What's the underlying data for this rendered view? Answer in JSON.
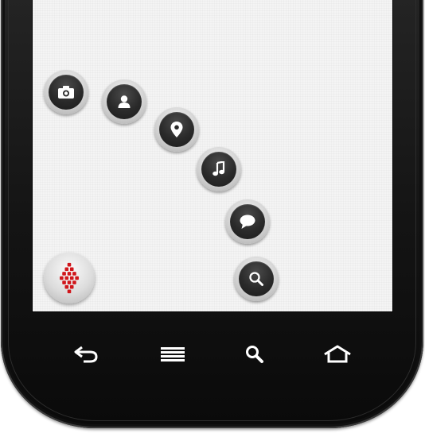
{
  "device": {
    "body_color": "#141414",
    "screen_color": "#f4f4f4"
  },
  "launcher": {
    "main_button_icon": "red-dots-menu-icon",
    "accent_color": "#d0161b",
    "actions": [
      {
        "id": "camera",
        "icon": "camera-icon"
      },
      {
        "id": "contact",
        "icon": "person-icon"
      },
      {
        "id": "location",
        "icon": "location-pin-icon"
      },
      {
        "id": "music",
        "icon": "music-note-icon"
      },
      {
        "id": "message",
        "icon": "speech-bubble-icon"
      },
      {
        "id": "search",
        "icon": "search-icon"
      }
    ]
  },
  "nav_keys": [
    {
      "id": "back",
      "icon": "back-arrow-icon"
    },
    {
      "id": "menu",
      "icon": "menu-lines-icon"
    },
    {
      "id": "search",
      "icon": "search-icon"
    },
    {
      "id": "home",
      "icon": "home-icon"
    }
  ]
}
